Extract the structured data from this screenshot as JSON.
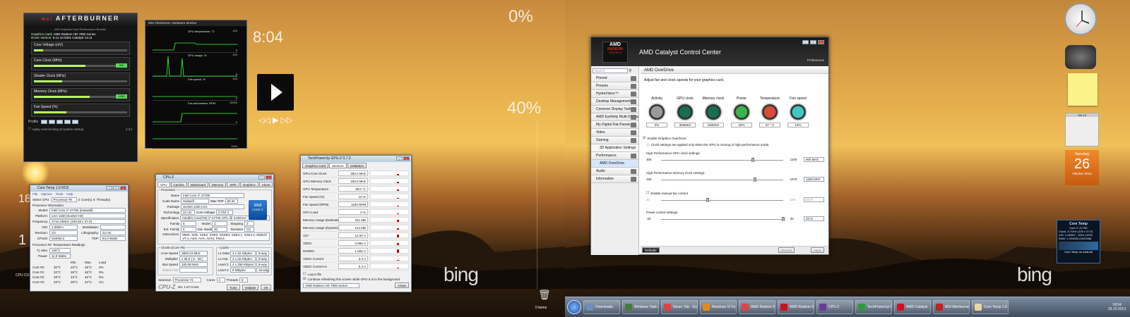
{
  "left": {
    "bing": "bing",
    "meters": {
      "cpu_pct": "0%",
      "ram_pct": "40%",
      "time": "8:04",
      "date_small": "26.10.2013",
      "n18": "18",
      "n1": "1",
      "cpu_core": "CPU CORE"
    }
  },
  "right": {
    "bing": "bing"
  },
  "afterburner": {
    "logo": "AFTERBURNER",
    "brand": "msi",
    "banner": "MSI Graphics Card Performance Booster",
    "card_label": "Graphics Card:",
    "card": "AMD Radeon HD 7900 Series",
    "driver_label": "Driver Version:",
    "driver": "8.14.10.0001 Catalyst 13.11",
    "sliders": [
      {
        "label": "Core Voltage (mV)",
        "fill": 0.1,
        "val": ""
      },
      {
        "label": "Core Clock (MHz)",
        "fill": 0.55,
        "val": "900"
      },
      {
        "label": "Shader Clock (MHz)",
        "fill": 0.3,
        "val": ""
      },
      {
        "label": "Memory Clock (MHz)",
        "fill": 0.6,
        "val": "1250"
      },
      {
        "label": "Fan Speed (%)",
        "fill": 0.35,
        "val": ""
      }
    ],
    "min": "Min",
    "max": "Max",
    "profile": "Profile",
    "apply_text": "Apply overclocking at system startup",
    "version": "2.3.1"
  },
  "abmon": {
    "title": "MSI Afterburner Hardware Monitor",
    "graphs": [
      {
        "label": "GPU temperature, °C",
        "top": "100",
        "bot": "0"
      },
      {
        "label": "GPU usage, %",
        "top": "100",
        "bot": "0"
      },
      {
        "label": "Fan speed, %",
        "top": "100",
        "bot": "0"
      },
      {
        "label": "Fan tachometer, RPM",
        "top": "10000",
        "bot": "0"
      },
      {
        "label": "",
        "top": "",
        "bot": "1100"
      }
    ]
  },
  "coretemp_left": {
    "title": "Core Temp 1.0 RC6",
    "menu": [
      "File",
      "Options",
      "Tools",
      "Help"
    ],
    "select_cpu": "Select CPU:",
    "proc_sel": "Processor #0",
    "cores": "4",
    "cores_l": "Core(s)",
    "threads": "8",
    "threads_l": "Thread(s)",
    "info_title": "Processor Information",
    "model_l": "Model:",
    "model": "Intel Core i7 4770K (Haswell)",
    "platform_l": "Platform:",
    "platform": "LGA 1150 (Socket H3)",
    "freq_l": "Frequency:",
    "freq": "3710.24MHz (100.28 x 37.0)",
    "vid_l": "VID:",
    "vid": "1.0839 v",
    "mod_l": "Modulation:",
    "rev_l": "Revision:",
    "rev": "C0",
    "litho_l": "Lithography:",
    "litho": "22 nm",
    "cpuid_l": "CPUID:",
    "cpuid": "0x306C3",
    "tdp_l": "TDP:",
    "tdp": "84.0 Watts",
    "readings_title": "Processor #0: Temperature Readings",
    "tjmax_l": "Tj. Max:",
    "tjmax": "100°C",
    "power_l": "Power:",
    "power": "11.9 Watts",
    "cols": [
      "",
      "Min.",
      "Max.",
      "Load"
    ],
    "cores_rows": [
      [
        "Core #0:",
        "30°C",
        "23°C",
        "45°C",
        "2%"
      ],
      [
        "Core #1:",
        "32°C",
        "26°C",
        "46°C",
        "0%"
      ],
      [
        "Core #2:",
        "29°C",
        "23°C",
        "46°C",
        "0%"
      ],
      [
        "Core #3:",
        "33°C",
        "28°C",
        "44°C",
        "1%"
      ]
    ]
  },
  "cpuz": {
    "title": "CPU-Z",
    "tabs": [
      "CPU",
      "Caches",
      "Mainboard",
      "Memory",
      "SPD",
      "Graphics",
      "About"
    ],
    "proc_group": "Processor",
    "name_l": "Name",
    "name": "Intel Core i7 4770K",
    "code_l": "Code Name",
    "code": "Haswell",
    "tdp_l": "Max TDP",
    "tdp": "84 W",
    "pkg_l": "Package",
    "pkg": "Socket 1150 LGA",
    "tech_l": "Technology",
    "tech": "22 nm",
    "cv_l": "Core Voltage",
    "cv": "0.794 V",
    "spec_l": "Specification",
    "spec": "Intel(R) Core(TM) i7-4770K CPU @ 3.50GHz",
    "fam_l": "Family",
    "fam": "6",
    "model_l": "Model",
    "model": "C",
    "step_l": "Stepping",
    "step": "3",
    "efam_l": "Ext. Family",
    "efam": "6",
    "emod_l": "Ext. Model",
    "emod": "3C",
    "rev_l": "Revision",
    "rev": "C0",
    "instr_l": "Instructions",
    "instr": "MMX, SSE, SSE2, SSE3, SSSE3, SSE4.1, SSE4.2, EM64T, VT-x, AES, AVX, AVX2, FMA3",
    "clocks_group": "Clocks (Core #0)",
    "cs_l": "Core Speed",
    "cs": "3803.24 MHz",
    "mult_l": "Multiplier",
    "mult": "x 38.0 ( 8 - 39 )",
    "bus_l": "Bus Speed",
    "bus": "100.09 MHz",
    "fsb_l": "Rated FSB",
    "cache_group": "Cache",
    "l1d_l": "L1 Data",
    "l1d": "4 x 32 KBytes",
    "l1d_w": "8-way",
    "l1i_l": "L1 Inst.",
    "l1i": "4 x 32 KBytes",
    "l1i_w": "8-way",
    "l2_l": "Level 2",
    "l2": "4 x 256 KBytes",
    "l2_w": "8-way",
    "l3_l": "Level 3",
    "l3": "8 MBytes",
    "l3_w": "16-way",
    "sel_l": "Selection",
    "sel": "Processor #1",
    "cores_l": "Cores",
    "cores": "4",
    "thr_l": "Threads",
    "thr": "8",
    "logo": "CPU-Z",
    "ver": "Ver. 1.67.0.x64",
    "tools": "Tools",
    "validate": "Validate",
    "ok": "OK",
    "intel_inside": "intel",
    "intel_core": "CORE i7"
  },
  "gpuz": {
    "title": "TechPowerUp GPU-Z 0.7.3",
    "tabs": [
      "Graphics Card",
      "Sensors",
      "Validation"
    ],
    "rows": [
      {
        "n": "GPU Core Clock",
        "v": "300.0 MHz",
        "h": 0.3
      },
      {
        "n": "GPU Memory Clock",
        "v": "150.0 MHz",
        "h": 0.3
      },
      {
        "n": "GPU Temperature",
        "v": "38.0 °C",
        "h": 0.4
      },
      {
        "n": "Fan Speed (%)",
        "v": "10 %",
        "h": 0.2
      },
      {
        "n": "Fan Speed (RPM)",
        "v": "1150 RPM",
        "h": 0.25
      },
      {
        "n": "GPU Load",
        "v": "0 %",
        "h": 0.1
      },
      {
        "n": "Memory Usage (Dedicated)",
        "v": "221 MB",
        "h": 0.5
      },
      {
        "n": "Memory Usage (Dynamic)",
        "v": "144 MB",
        "h": 0.4
      },
      {
        "n": "12V",
        "v": "12.00 V",
        "h": 0.6
      },
      {
        "n": "VDDC",
        "v": "0.865 V",
        "h": 0.5
      },
      {
        "n": "MVDDC",
        "v": "1.602 V",
        "h": 0.9
      },
      {
        "n": "VDDC Current",
        "v": "3.3 A",
        "h": 0.2
      },
      {
        "n": "VDDC Current In",
        "v": "0.3 A",
        "h": 0.1
      }
    ],
    "log": "Log to file",
    "cont": "Continue refreshing this screen while GPU-Z is in the background",
    "card": "AMD Radeon HD 7900 Series",
    "close": "Close"
  },
  "ccc": {
    "brand": "AMD",
    "radeon": "RADEON",
    "graphics": "GRAPHICS",
    "title": "AMD Catalyst Control Center",
    "prefs": "Preferences",
    "search": "Search",
    "nav": [
      "Pinned",
      "Presets",
      "HydraVision™",
      "Desktop Management",
      "Common Display Tasks",
      "AMD Eyefinity Multi-Display",
      "My Digital Flat-Panels",
      "Video",
      "Gaming",
      "3D Application Settings",
      "Performance",
      "AMD OverDrive",
      "Audio",
      "Information"
    ],
    "section": "AMD OverDrive",
    "desc": "Adjust fan and clock speeds for your graphics card.",
    "gauges": [
      {
        "l": "Activity",
        "v": "0%"
      },
      {
        "l": "GPU clock",
        "v": "300MHz"
      },
      {
        "l": "Memory clock",
        "v": "150MHz"
      },
      {
        "l": "Power",
        "v": "20%"
      },
      {
        "l": "Temperature",
        "v": "37 ° C"
      },
      {
        "l": "Fan speed",
        "v": "10%"
      }
    ],
    "enable": "Enable Graphics OverDrive",
    "note": "Clock settings are applied only when the GPU is running in high-performance mode.",
    "gpu_clock_l": "High Performance GPU clock settings:",
    "gpu_min": "300",
    "gpu_max": "1100",
    "gpu_val": "900 MHz",
    "gpu_pos": 0.75,
    "mem_clock_l": "High Performance memory clock settings:",
    "mem_min": "150",
    "mem_max": "1575",
    "mem_val": "1250 MHz",
    "mem_pos": 0.77,
    "fan_l": "Enable manual fan control",
    "fan_min": "20",
    "fan_max": "100",
    "fan_val": "50 %",
    "fan_pos": 0.38,
    "power_l": "Power control settings:",
    "p_min": "-20",
    "p_max": "20",
    "p_val": "20 %",
    "p_pos": 1.0,
    "defaults": "Defaults",
    "discard": "Discard",
    "apply": "Apply"
  },
  "gadgets": {
    "cal_day": "Samstag",
    "cal_date": "26",
    "cal_month": "Oktober 2013",
    "cal_head": "Okt 13",
    "coretemp_title": "Core Temp",
    "coretemp_sub": "Core i7 4770K",
    "ct_lines": [
      "Clock: 3.7GHz (100 x 37.0)",
      "VID: 1.0839V - 50Hz 100%",
      "RAM: 1.4/16GB (16/2288)"
    ],
    "ct_footer": "Core Temp on Android"
  },
  "taskbar": {
    "items": [
      "Downloads",
      "Windows Task-...",
      "Neuer Tab - Go...",
      "Maximus VI Fo...",
      "AMD Radeon R...",
      "AMD Radeon R...",
      "CPU-Z",
      "TechPowerUp G...",
      "AMD Catalyst ...",
      "MSI Afterburner",
      "Core Temp 1.0 ..."
    ],
    "time": "18:04",
    "date": "26.10.2013",
    "recycle": "0 items"
  }
}
